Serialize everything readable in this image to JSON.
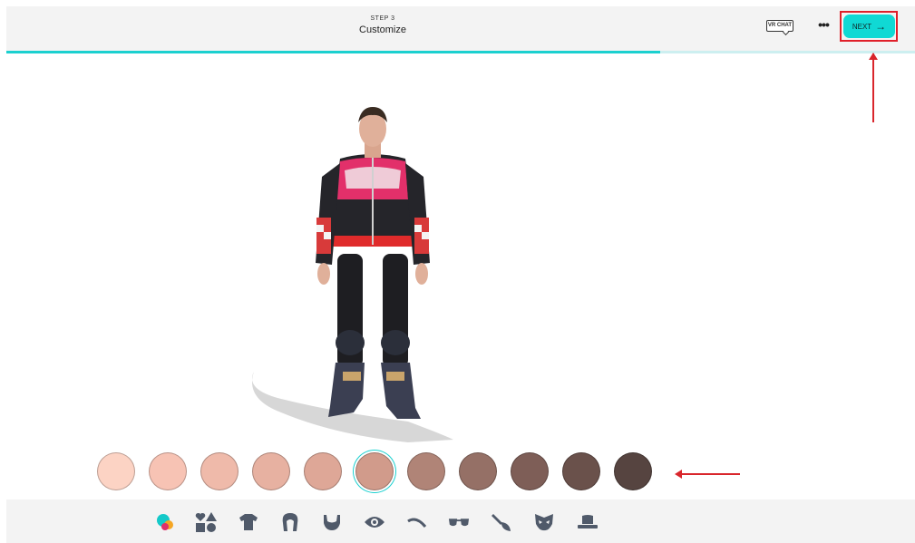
{
  "header": {
    "step_label": "STEP 3",
    "title": "Customize",
    "badge": "VR CHAT",
    "more_label": "•••",
    "next_label": "NEXT",
    "progress_fraction": 0.72
  },
  "colors": {
    "accent": "#1bd0cf",
    "next_button": "#10d9d4",
    "annotation": "#d9262c"
  },
  "skin_swatches": [
    {
      "color": "#fcd3c4",
      "selected": false
    },
    {
      "color": "#f7c3b4",
      "selected": false
    },
    {
      "color": "#efbaaa",
      "selected": false
    },
    {
      "color": "#e7b1a1",
      "selected": false
    },
    {
      "color": "#dea797",
      "selected": false
    },
    {
      "color": "#d19b8b",
      "selected": true
    },
    {
      "color": "#b08477",
      "selected": false
    },
    {
      "color": "#957066",
      "selected": false
    },
    {
      "color": "#7e5e57",
      "selected": false
    },
    {
      "color": "#6a514b",
      "selected": false
    },
    {
      "color": "#564440",
      "selected": false
    }
  ],
  "category_icons": [
    "skin-color-icon",
    "body-shape-icon",
    "shirt-icon",
    "hair-icon",
    "beard-icon",
    "eye-icon",
    "eyebrow-icon",
    "glasses-icon",
    "makeup-brush-icon",
    "mask-icon",
    "hat-icon"
  ]
}
